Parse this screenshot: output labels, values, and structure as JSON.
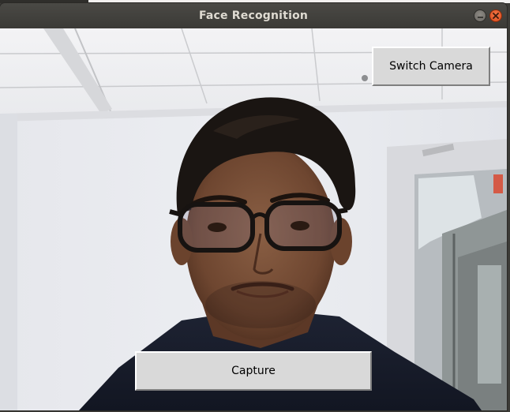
{
  "window": {
    "title": "Face Recognition"
  },
  "controls": {
    "switch_camera_label": "Switch Camera",
    "capture_label": "Capture"
  },
  "colors": {
    "titlebar": "#3c3b37",
    "title_text": "#dfdbd2",
    "close_button": "#e95420",
    "button_face": "#d9d9d9"
  },
  "icons": {
    "minimize": "minimize-icon",
    "close": "close-icon"
  }
}
